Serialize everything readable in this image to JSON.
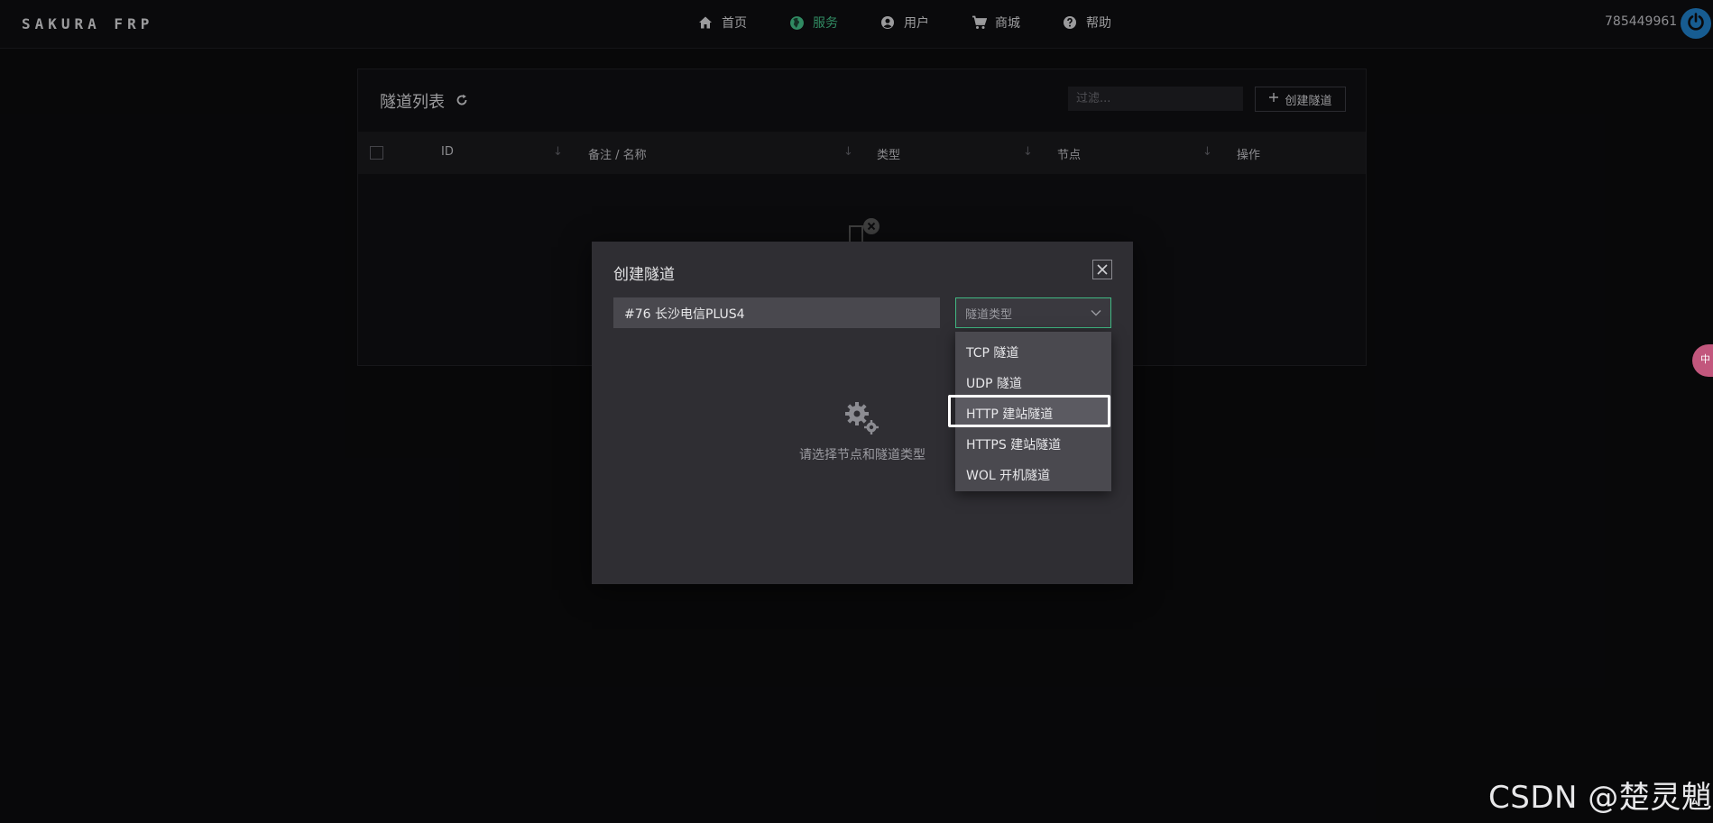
{
  "brand": "SAKURA FRP",
  "nav": [
    {
      "label": "首页",
      "icon": "home-icon",
      "active": false
    },
    {
      "label": "服务",
      "icon": "globe-icon",
      "active": true
    },
    {
      "label": "用户",
      "icon": "user-circle-icon",
      "active": false
    },
    {
      "label": "商城",
      "icon": "cart-icon",
      "active": false
    },
    {
      "label": "帮助",
      "icon": "help-circle-icon",
      "active": false
    }
  ],
  "user_id": "785449961",
  "accent_color": "#41b883",
  "card": {
    "title": "隧道列表",
    "filter_placeholder": "过滤...",
    "create_label": "创建隧道",
    "columns": [
      "ID",
      "备注 / 名称",
      "类型",
      "节点",
      "操作"
    ]
  },
  "modal": {
    "title": "创建隧道",
    "node_value": "#76 长沙电信PLUS4",
    "type_placeholder": "隧道类型",
    "empty_text": "请选择节点和隧道类型"
  },
  "dropdown": {
    "options": [
      "TCP 隧道",
      "UDP 隧道",
      "HTTP 建站隧道",
      "HTTPS 建站隧道",
      "WOL 开机隧道"
    ],
    "highlighted": "HTTP 建站隧道"
  },
  "side_tab": "中",
  "watermark": "CSDN @楚灵魈"
}
